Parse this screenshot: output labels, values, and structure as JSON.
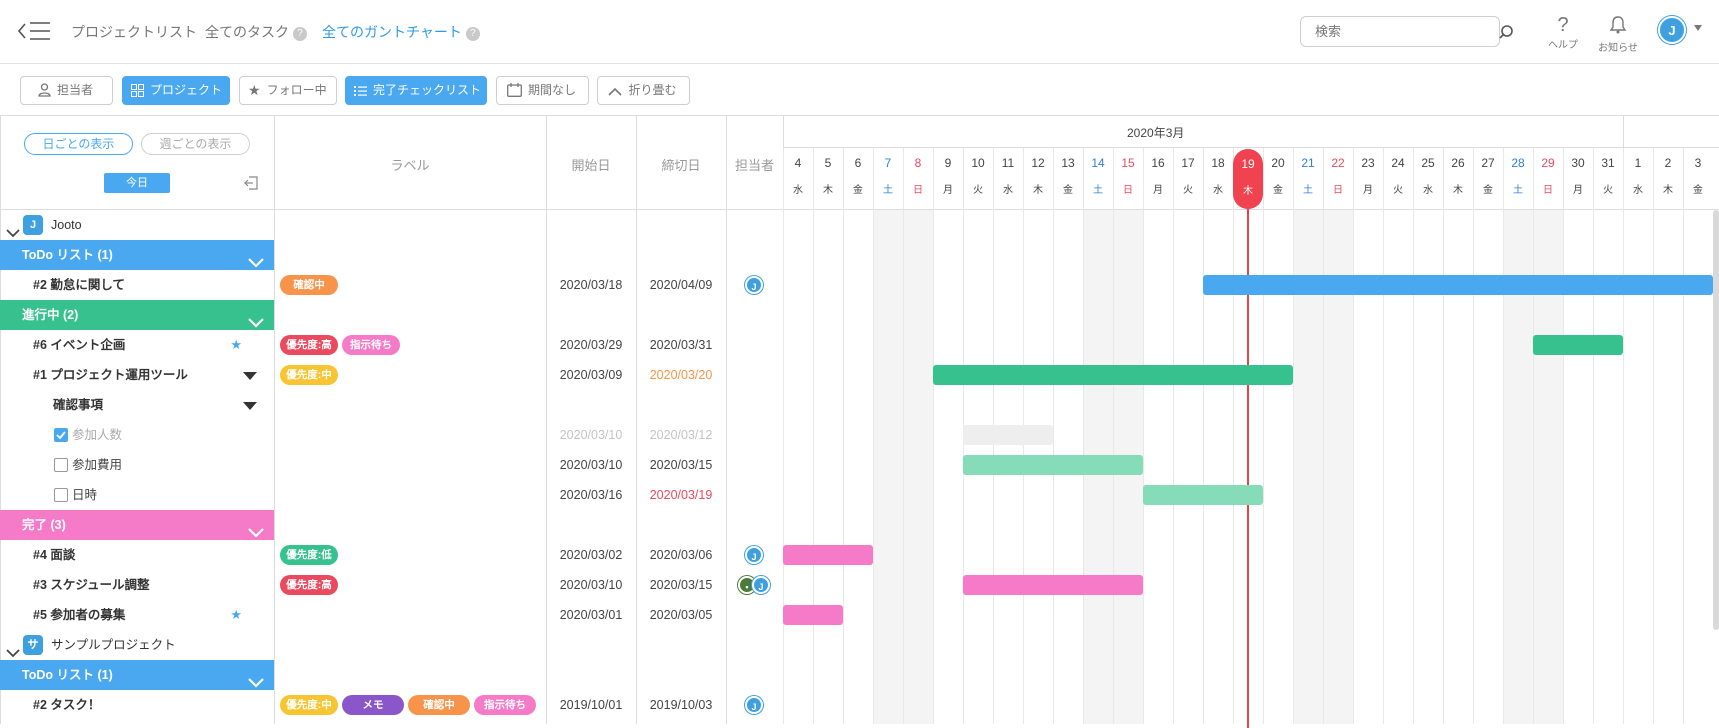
{
  "header": {
    "nav": [
      {
        "label": "プロジェクトリスト"
      },
      {
        "label": "全てのタスク",
        "help": "?"
      },
      {
        "label": "全てのガントチャート",
        "help": "?"
      }
    ],
    "search_placeholder": "検索",
    "help_label": "ヘルプ",
    "notify_label": "お知らせ",
    "help_glyph": "?"
  },
  "toolbar": {
    "assignee": "担当者",
    "project": "プロジェクト",
    "following": "フォロー中",
    "done_checklist": "完了チェックリスト",
    "no_deadline": "期間なし",
    "collapse": "折り畳む"
  },
  "sidebar": {
    "daily": "日ごとの表示",
    "weekly": "週ごとの表示",
    "today": "今日"
  },
  "columns": {
    "label": "ラベル",
    "start": "開始日",
    "end": "締切日",
    "assignee": "担当者"
  },
  "gantt": {
    "month": "2020年3月",
    "today_index": 15,
    "days": [
      {
        "d": "4",
        "w": "水"
      },
      {
        "d": "5",
        "w": "木"
      },
      {
        "d": "6",
        "w": "金"
      },
      {
        "d": "7",
        "w": "土"
      },
      {
        "d": "8",
        "w": "日"
      },
      {
        "d": "9",
        "w": "月"
      },
      {
        "d": "10",
        "w": "火"
      },
      {
        "d": "11",
        "w": "水"
      },
      {
        "d": "12",
        "w": "木"
      },
      {
        "d": "13",
        "w": "金"
      },
      {
        "d": "14",
        "w": "土"
      },
      {
        "d": "15",
        "w": "日"
      },
      {
        "d": "16",
        "w": "月"
      },
      {
        "d": "17",
        "w": "火"
      },
      {
        "d": "18",
        "w": "水"
      },
      {
        "d": "19",
        "w": "木"
      },
      {
        "d": "20",
        "w": "金"
      },
      {
        "d": "21",
        "w": "土"
      },
      {
        "d": "22",
        "w": "日"
      },
      {
        "d": "23",
        "w": "月"
      },
      {
        "d": "24",
        "w": "火"
      },
      {
        "d": "25",
        "w": "水"
      },
      {
        "d": "26",
        "w": "木"
      },
      {
        "d": "27",
        "w": "金"
      },
      {
        "d": "28",
        "w": "土"
      },
      {
        "d": "29",
        "w": "日"
      },
      {
        "d": "30",
        "w": "月"
      },
      {
        "d": "31",
        "w": "火"
      },
      {
        "d": "1",
        "w": "水"
      },
      {
        "d": "2",
        "w": "木"
      },
      {
        "d": "3",
        "w": "金"
      }
    ]
  },
  "rows": [
    {
      "kind": "project",
      "name": "Jooto",
      "icon": "J"
    },
    {
      "kind": "group",
      "name": "ToDo リスト (1)",
      "color": "#4aa8f0"
    },
    {
      "kind": "task",
      "name": "#2 勤怠に関して",
      "labels": [
        {
          "t": "確認中",
          "c": "#f7934a",
          "w": 58
        }
      ],
      "start": "2020/03/18",
      "end": "2020/04/09",
      "assignee": [
        "J"
      ],
      "bar": {
        "from": "2020-03-18",
        "to": "2020-04-09",
        "color": "#4aa8f0"
      }
    },
    {
      "kind": "group",
      "name": "進行中 (2)",
      "color": "#37c18f"
    },
    {
      "kind": "task",
      "name": "#6 イベント企画",
      "star": true,
      "labels": [
        {
          "t": "優先度:高",
          "c": "#ea4a5e",
          "w": 58
        },
        {
          "t": "指示待ち",
          "c": "#f57ac7",
          "w": 58
        }
      ],
      "start": "2020/03/29",
      "end": "2020/03/31",
      "bar": {
        "from": "2020-03-29",
        "to": "2020-03-31",
        "color": "#37c18f"
      }
    },
    {
      "kind": "task",
      "name": "#1 プロジェクト運用ツール",
      "expand": true,
      "labels": [
        {
          "t": "優先度:中",
          "c": "#f7c531",
          "w": 58
        }
      ],
      "start": "2020/03/09",
      "end": "2020/03/20",
      "endColor": "#f7934a",
      "bar": {
        "from": "2020-03-09",
        "to": "2020-03-20",
        "color": "#37c18f"
      }
    },
    {
      "kind": "sub",
      "name": "確認事項",
      "expand": true
    },
    {
      "kind": "check",
      "name": "参加人数",
      "checked": true,
      "start": "2020/03/10",
      "end": "2020/03/12",
      "muted": true,
      "bar": {
        "from": "2020-03-10",
        "to": "2020-03-12",
        "color": "#eeeeee"
      }
    },
    {
      "kind": "check",
      "name": "参加費用",
      "checked": false,
      "start": "2020/03/10",
      "end": "2020/03/15",
      "bar": {
        "from": "2020-03-10",
        "to": "2020-03-15",
        "color": "#86dcb9"
      }
    },
    {
      "kind": "check",
      "name": "日時",
      "checked": false,
      "start": "2020/03/16",
      "end": "2020/03/19",
      "endColor": "#ea4a5e",
      "bar": {
        "from": "2020-03-16",
        "to": "2020-03-19",
        "color": "#86dcb9"
      }
    },
    {
      "kind": "group",
      "name": "完了 (3)",
      "color": "#f57ac7"
    },
    {
      "kind": "task",
      "name": "#4 面談",
      "labels": [
        {
          "t": "優先度:低",
          "c": "#37c18f",
          "w": 58
        }
      ],
      "start": "2020/03/02",
      "end": "2020/03/06",
      "assignee": [
        "J"
      ],
      "bar": {
        "from": "2020-03-02",
        "to": "2020-03-06",
        "color": "#f57ac7"
      }
    },
    {
      "kind": "task",
      "name": "#3 スケジュール調整",
      "labels": [
        {
          "t": "優先度:高",
          "c": "#ea4a5e",
          "w": 58
        }
      ],
      "start": "2020/03/10",
      "end": "2020/03/15",
      "assignee": [
        "•",
        "J"
      ],
      "bar": {
        "from": "2020-03-10",
        "to": "2020-03-15",
        "color": "#f57ac7"
      }
    },
    {
      "kind": "task",
      "name": "#5 参加者の募集",
      "star": true,
      "start": "2020/03/01",
      "end": "2020/03/05",
      "bar": {
        "from": "2020-03-01",
        "to": "2020-03-05",
        "color": "#f57ac7"
      }
    },
    {
      "kind": "project",
      "name": "サンプルプロジェクト",
      "icon": "サ"
    },
    {
      "kind": "group",
      "name": "ToDo リスト (1)",
      "color": "#4aa8f0"
    },
    {
      "kind": "task",
      "name": "#2 タスク！",
      "labels": [
        {
          "t": "優先度:中",
          "c": "#f7c531",
          "w": 58
        },
        {
          "t": "メモ",
          "c": "#8a56c9",
          "w": 62
        },
        {
          "t": "確認中",
          "c": "#f7934a",
          "w": 62
        },
        {
          "t": "指示待ち",
          "c": "#f57ac7",
          "w": 62
        }
      ],
      "start": "2019/10/01",
      "end": "2019/10/03",
      "assignee": [
        "J"
      ]
    }
  ]
}
